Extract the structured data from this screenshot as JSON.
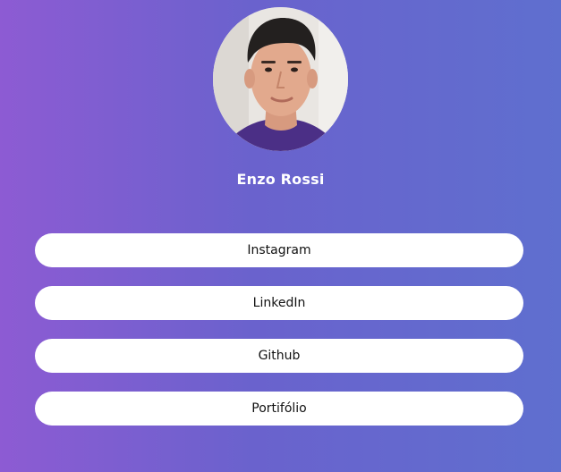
{
  "profile": {
    "name": "Enzo Rossi",
    "avatar_icon": "profile-photo"
  },
  "links": [
    {
      "label": "Instagram"
    },
    {
      "label": "LinkedIn"
    },
    {
      "label": "Github"
    },
    {
      "label": "Portifólio"
    }
  ],
  "colors": {
    "gradient_start": "#8d5bd3",
    "gradient_end": "#5f6fcf",
    "button_bg": "#ffffff",
    "button_text": "#111111",
    "name_text": "#ffffff"
  }
}
